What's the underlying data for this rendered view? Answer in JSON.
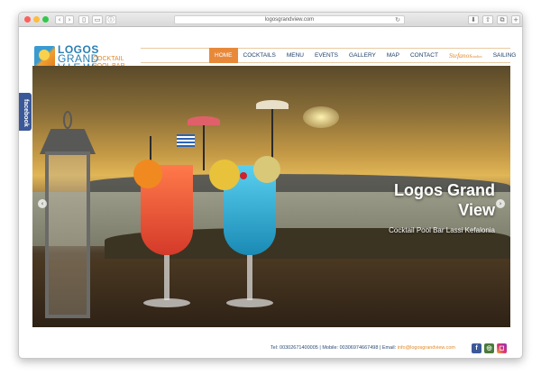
{
  "browser": {
    "address": "logosgrandview.com"
  },
  "logo": {
    "line1": "LOGOS",
    "line2": "GRAND",
    "line3": "VIEW",
    "sub1": "COCKTAIL",
    "sub2": "POOL BAR"
  },
  "nav": {
    "items": [
      "HOME",
      "COCKTAILS",
      "MENU",
      "EVENTS",
      "GALLERY",
      "MAP",
      "CONTACT"
    ],
    "brand": "Stefanos",
    "brand_small": "studios",
    "last": "SAILING"
  },
  "hero": {
    "title_line1": "Logos Grand",
    "title_line2": "View",
    "subtitle": "Cocktail Pool Bar Lassi Kefalonia"
  },
  "sidebar": {
    "facebook_label": "facebook"
  },
  "footer": {
    "contact": "Tel: 00302671400005 | Mobile: 00306974667498 | Email: ",
    "email": "info@logosgrandview.com"
  },
  "colors": {
    "accent": "#e8893a",
    "nav_text": "#1e3f6a",
    "logo_blue": "#2a7fb5",
    "facebook": "#3b5998"
  }
}
